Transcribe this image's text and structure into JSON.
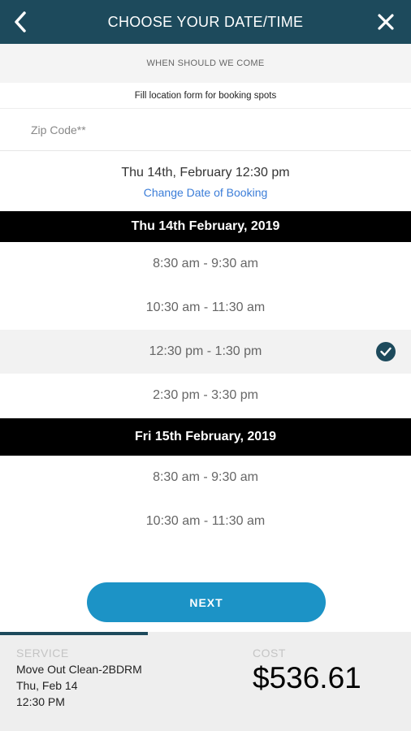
{
  "header": {
    "title": "CHOOSE YOUR DATE/TIME",
    "back_icon": "chevron-left-icon",
    "close_icon": "close-icon"
  },
  "banner": {
    "when": "WHEN SHOULD WE COME",
    "fill_location": "Fill location form for booking spots"
  },
  "zip": {
    "placeholder": "Zip Code**",
    "value": ""
  },
  "booking": {
    "selected_datetime": "Thu 14th, February 12:30 pm",
    "change_link": "Change Date of Booking"
  },
  "days": [
    {
      "label": "Thu 14th February, 2019",
      "slots": [
        {
          "label": "8:30 am - 9:30 am",
          "selected": false
        },
        {
          "label": "10:30 am - 11:30 am",
          "selected": false
        },
        {
          "label": "12:30 pm - 1:30 pm",
          "selected": true
        },
        {
          "label": "2:30 pm - 3:30 pm",
          "selected": false
        }
      ]
    },
    {
      "label": "Fri 15th February, 2019",
      "slots": [
        {
          "label": "8:30 am - 9:30 am",
          "selected": false
        },
        {
          "label": "10:30 am - 11:30 am",
          "selected": false
        }
      ]
    }
  ],
  "next_button": "NEXT",
  "footer": {
    "progress": 0.36,
    "service_label": "SERVICE",
    "service_name": "Move Out Clean-2BDRM",
    "service_date": "Thu, Feb 14",
    "service_time": "12:30 PM",
    "cost_label": "COST",
    "cost_value": "$536.61"
  },
  "colors": {
    "header_bg": "#1d4a5c",
    "accent_button": "#1c93c6",
    "link": "#3b7dd8",
    "day_header_bg": "#000000"
  }
}
